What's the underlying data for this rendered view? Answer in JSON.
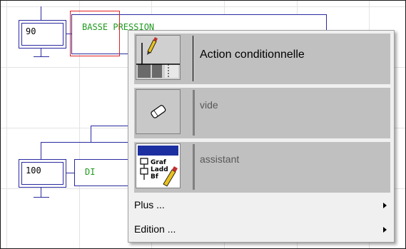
{
  "diagram": {
    "step1_number": "90",
    "step1_action": "BASSE PRESSION",
    "step2_number": "100",
    "step2_action_partial": "DI"
  },
  "context_menu": {
    "items": [
      {
        "label": "Action conditionnelle",
        "icon": "pencil-action-icon"
      },
      {
        "label": "vide",
        "icon": "eraser-icon"
      },
      {
        "label": "assistant",
        "icon": "graf-assistant-icon"
      }
    ],
    "submenus": [
      {
        "label": "Plus ...",
        "icon": "submenu-arrow-icon"
      },
      {
        "label": "Edition ...",
        "icon": "submenu-arrow-icon"
      }
    ]
  }
}
